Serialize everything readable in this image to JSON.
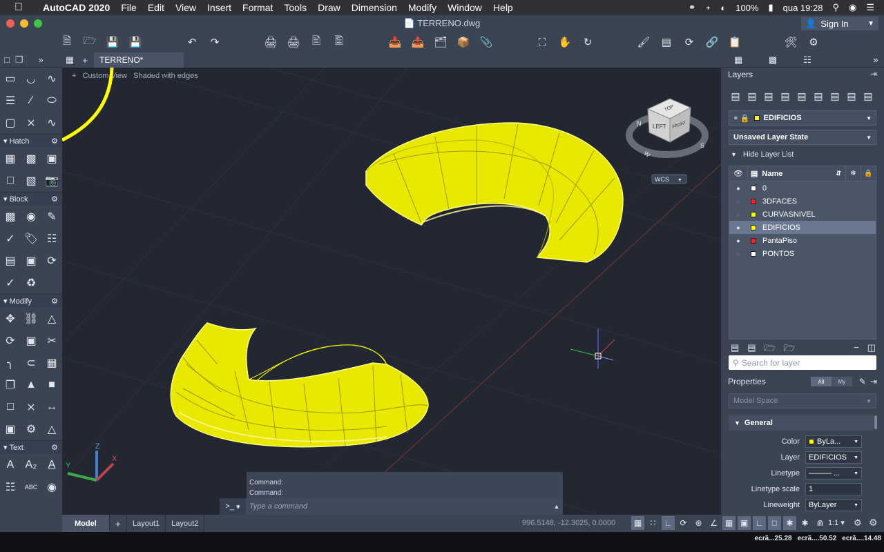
{
  "menubar": {
    "app": "AutoCAD 2020",
    "items": [
      "File",
      "Edit",
      "View",
      "Insert",
      "Format",
      "Tools",
      "Draw",
      "Dimension",
      "Modify",
      "Window",
      "Help"
    ],
    "battery": "100%",
    "clock": "qua 19:28"
  },
  "window": {
    "title": "TERRENO.dwg",
    "sign_in": "Sign In",
    "traffic_colors": [
      "#ee5f57",
      "#f5bd2f",
      "#3cc840"
    ]
  },
  "palette": {
    "sections": {
      "hatch": "Hatch",
      "block": "Block",
      "modify": "Modify",
      "text": "Text"
    }
  },
  "tabs": {
    "document": "TERRENO*"
  },
  "viewport": {
    "plus": "+",
    "view": "Custom View",
    "style": "Shaded with edges",
    "viewcube": {
      "face_top": "TOP",
      "face_left": "LEFT",
      "face_front": "FRONT",
      "compass_n": "N",
      "compass_w": "W",
      "compass_s": "S",
      "wcs": "WCS"
    },
    "ucs": {
      "x": "X",
      "y": "Y",
      "z": "Z"
    },
    "object_color": "#ffff00"
  },
  "command": {
    "history_1": "Command:",
    "history_2": "Command:",
    "prompt": ">_",
    "placeholder": "Type a command"
  },
  "layers_panel": {
    "title": "Layers",
    "current_layer": "EDIFICIOS",
    "layer_state": "Unsaved Layer State",
    "hide_list": "Hide Layer List",
    "column_name": "Name",
    "layers": [
      {
        "name": "0",
        "color": "#ffffff",
        "on": true
      },
      {
        "name": "3DFACES",
        "color": "#ff2020",
        "on": false
      },
      {
        "name": "CURVASNIVEL",
        "color": "#ffff00",
        "on": false
      },
      {
        "name": "EDIFICIOS",
        "color": "#ffff00",
        "on": true
      },
      {
        "name": "PantaPiso",
        "color": "#ff2020",
        "on": true
      },
      {
        "name": "PONTOS",
        "color": "#ffffff",
        "on": false
      }
    ],
    "selected_layer": "EDIFICIOS",
    "search_placeholder": "Search for layer"
  },
  "properties_panel": {
    "title": "Properties",
    "filter_all": "All",
    "filter_my": "My",
    "space": "Model Space",
    "section": "General",
    "rows": {
      "color_label": "Color",
      "color_value": "ByLa...",
      "layer_label": "Layer",
      "layer_value": "EDIFICIOS",
      "linetype_label": "Linetype",
      "linetype_value": "———   ...",
      "linetype_scale_label": "Linetype scale",
      "linetype_scale_value": "1",
      "lineweight_label": "Lineweight",
      "lineweight_value": "ByLayer"
    }
  },
  "statusbar": {
    "model": "Model",
    "layout1": "Layout1",
    "layout2": "Layout2",
    "coords": "996.5148, -12.3025, 0.0000",
    "scale": "1:1"
  },
  "dock": {
    "file1": "ecrã...25.28",
    "file2": "ecrã....50.52",
    "file3": "ecrã....14.48"
  }
}
